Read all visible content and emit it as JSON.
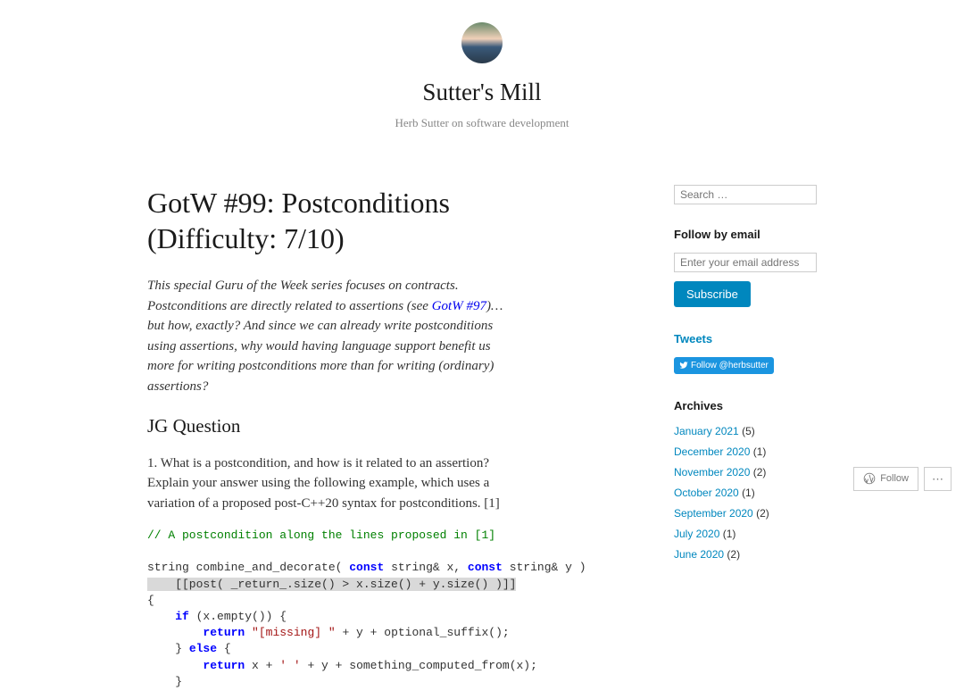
{
  "header": {
    "site_title": "Sutter's Mill",
    "tagline": "Herb Sutter on software development"
  },
  "post": {
    "title": "GotW #99: Postconditions (Difficulty: 7/10)",
    "intro_part1": "This special Guru of the Week series focuses on contracts. Postconditions are directly related to assertions (see ",
    "intro_link": "GotW #97",
    "intro_part2": ")… but how, exactly? And since we can already write postconditions using assertions, why would having language support benefit us more for writing postconditions more than for writing (ordinary) assertions?",
    "section_heading": "JG Question",
    "question_text": "1. What is a postcondition, and how is it related to an assertion? Explain your answer using the following example, which uses a variation of a proposed post-C++20 syntax for postconditions. [1]",
    "code": {
      "comment": "// A postcondition along the lines proposed in [1]",
      "line1_pre": "string combine_and_decorate( ",
      "line1_kw1": "const",
      "line1_mid1": " string& x, ",
      "line1_kw2": "const",
      "line1_end": " string& y )",
      "line2": "    [[post( _return_.size() > x.size() + y.size() )]]",
      "line3": "{",
      "line4_pre": "    ",
      "line4_kw": "if",
      "line4_end": " (x.empty()) {",
      "line5_pre": "        ",
      "line5_kw": "return",
      "line5_str": " \"[missing] \"",
      "line5_end": " + y + optional_suffix();",
      "line6_pre": "    } ",
      "line6_kw": "else",
      "line6_end": " {",
      "line7_pre": "        ",
      "line7_kw": "return",
      "line7_mid": " x + ",
      "line7_str": "' '",
      "line7_end": " + y + something_computed_from(x);",
      "line8": "    }"
    }
  },
  "sidebar": {
    "search_placeholder": "Search …",
    "follow_email_title": "Follow by email",
    "email_placeholder": "Enter your email address",
    "subscribe_label": "Subscribe",
    "tweets_title": "Tweets",
    "twitter_follow_label": "Follow @herbsutter",
    "archives_title": "Archives",
    "archives": [
      {
        "label": "January 2021",
        "count": "(5)"
      },
      {
        "label": "December 2020",
        "count": "(1)"
      },
      {
        "label": "November 2020",
        "count": "(2)"
      },
      {
        "label": "October 2020",
        "count": "(1)"
      },
      {
        "label": "September 2020",
        "count": "(2)"
      },
      {
        "label": "July 2020",
        "count": "(1)"
      },
      {
        "label": "June 2020",
        "count": "(2)"
      }
    ]
  },
  "footer": {
    "follow_label": "Follow",
    "dots": "⋯"
  }
}
